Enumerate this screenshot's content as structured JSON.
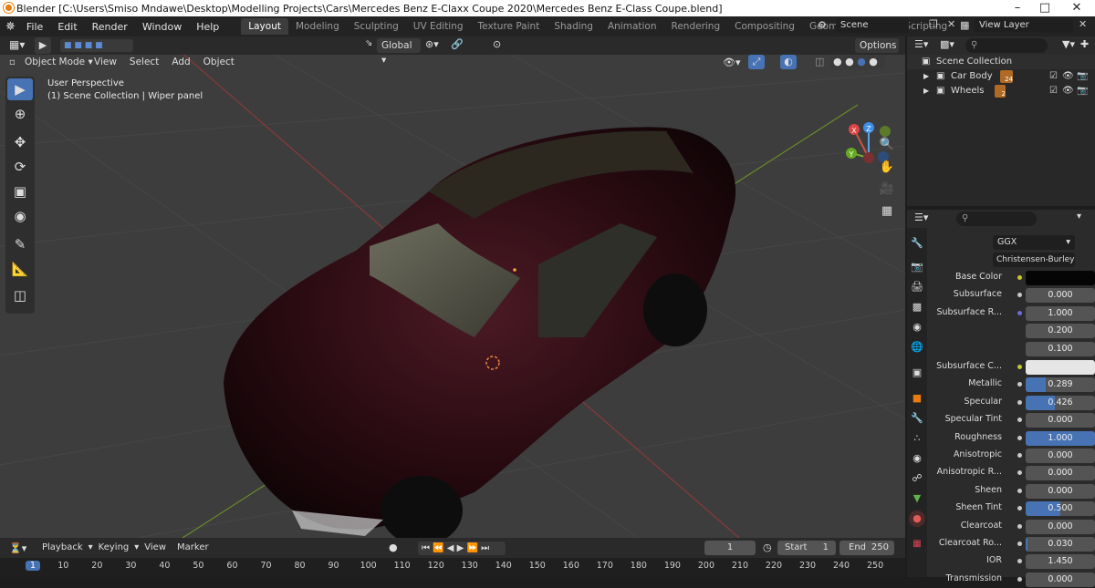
{
  "window": {
    "title": "Blender [C:\\Users\\Smiso Mndawe\\Desktop\\Modelling Projects\\Cars\\Mercedes Benz E-Claxx Coupe 2020\\Mercedes Benz E-Class Coupe.blend]"
  },
  "menu": [
    "File",
    "Edit",
    "Render",
    "Window",
    "Help"
  ],
  "workspaces": [
    "Layout",
    "Modeling",
    "Sculpting",
    "UV Editing",
    "Texture Paint",
    "Shading",
    "Animation",
    "Rendering",
    "Compositing",
    "Geometry Nodes",
    "Scripting"
  ],
  "active_workspace": "Layout",
  "scene": "Scene",
  "view_layer": "View Layer",
  "viewport": {
    "transform_orientation": "Global",
    "options": "Options",
    "mode": "Object Mode",
    "menus": [
      "View",
      "Select",
      "Add",
      "Object"
    ],
    "overlay_line1": "User Perspective",
    "overlay_line2": "(1) Scene Collection | Wiper panel",
    "gizmo": {
      "x": "X",
      "y": "Y",
      "z": "Z"
    }
  },
  "outliner": {
    "root": "Scene Collection",
    "items": [
      {
        "name": "Car Body",
        "badge": "24"
      },
      {
        "name": "Wheels",
        "badge": "2"
      }
    ]
  },
  "properties": {
    "distribution": "GGX",
    "subsurface_method": "Christensen-Burley",
    "rows": [
      {
        "label": "Base Color",
        "value": "",
        "kind": "color",
        "color": "#050505"
      },
      {
        "label": "Subsurface",
        "value": "0.000",
        "fill": 0
      },
      {
        "label": "Subsurface R...",
        "value": "1.000",
        "fill": 0
      },
      {
        "label": "",
        "value": "0.200",
        "fill": 0
      },
      {
        "label": "",
        "value": "0.100",
        "fill": 0
      },
      {
        "label": "Subsurface C...",
        "value": "",
        "kind": "color",
        "color": "#e6e6e6"
      },
      {
        "label": "Metallic",
        "value": "0.289",
        "fill": 0.289
      },
      {
        "label": "Specular",
        "value": "0.426",
        "fill": 0.426
      },
      {
        "label": "Specular Tint",
        "value": "0.000",
        "fill": 0
      },
      {
        "label": "Roughness",
        "value": "1.000",
        "fill": 1.0
      },
      {
        "label": "Anisotropic",
        "value": "0.000",
        "fill": 0
      },
      {
        "label": "Anisotropic R...",
        "value": "0.000",
        "fill": 0
      },
      {
        "label": "Sheen",
        "value": "0.000",
        "fill": 0
      },
      {
        "label": "Sheen Tint",
        "value": "0.500",
        "fill": 0.5
      },
      {
        "label": "Clearcoat",
        "value": "0.000",
        "fill": 0
      },
      {
        "label": "Clearcoat Ro...",
        "value": "0.030",
        "fill": 0.03
      },
      {
        "label": "IOR",
        "value": "1.450",
        "fill": 0
      },
      {
        "label": "Transmission",
        "value": "0.000",
        "fill": 0
      }
    ]
  },
  "timeline": {
    "menus": [
      "Playback",
      "Keying",
      "View",
      "Marker"
    ],
    "current_frame": "1",
    "start_label": "Start",
    "start": "1",
    "end_label": "End",
    "end": "250",
    "frames": [
      "1",
      "10",
      "20",
      "30",
      "40",
      "50",
      "60",
      "70",
      "80",
      "90",
      "100",
      "110",
      "120",
      "130",
      "140",
      "150",
      "160",
      "170",
      "180",
      "190",
      "200",
      "210",
      "220",
      "230",
      "240",
      "250"
    ]
  },
  "colors": {
    "accent": "#4772b3",
    "background": "#3d3d3d",
    "car_paint": "#3a0f1a"
  }
}
